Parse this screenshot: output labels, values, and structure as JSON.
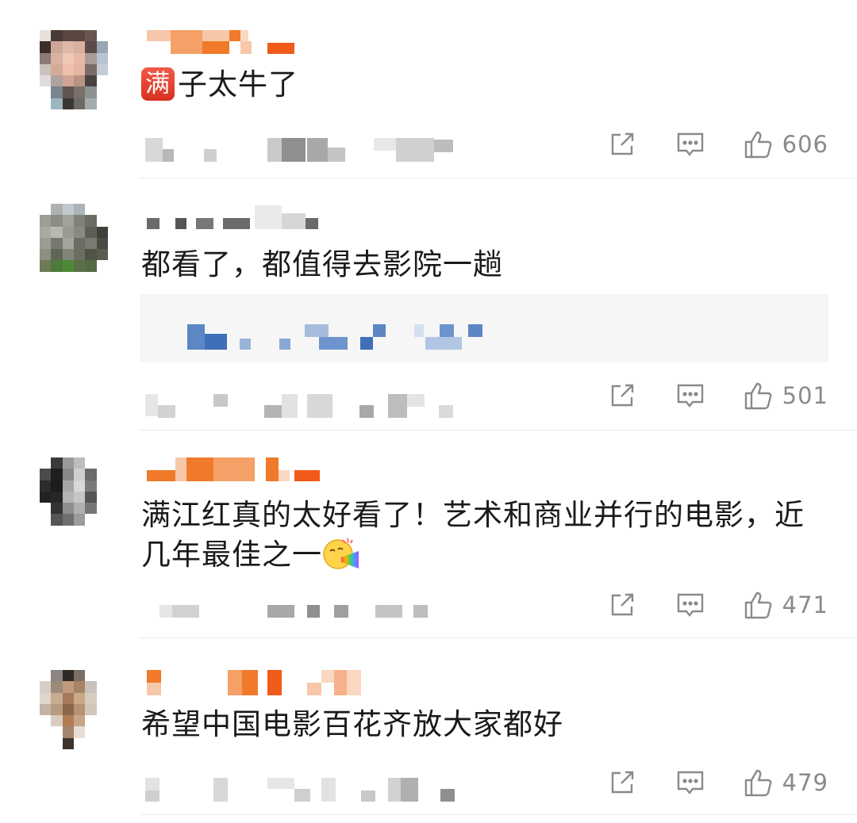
{
  "comments": [
    {
      "badge_text": "满",
      "text": "子太牛了",
      "likes": "606",
      "share_icon": "share-icon",
      "reply_icon": "comment-icon",
      "like_icon": "thumbs-up-icon"
    },
    {
      "text": "都看了，都值得去影院一趟",
      "likes": "501",
      "share_icon": "share-icon",
      "reply_icon": "comment-icon",
      "like_icon": "thumbs-up-icon"
    },
    {
      "text_line1": "满江红真的太好看了！艺术和商业并行的电影，近",
      "text_line2": "几年最佳之一",
      "emoji": "rainbow-vomit-emoji",
      "likes": "471",
      "share_icon": "share-icon",
      "reply_icon": "comment-icon",
      "like_icon": "thumbs-up-icon"
    },
    {
      "text": "希望中国电影百花齐放大家都好",
      "likes": "479",
      "share_icon": "share-icon",
      "reply_icon": "comment-icon",
      "like_icon": "thumbs-up-icon"
    }
  ],
  "colors": {
    "username_accent": "#f07a2a",
    "link_blue": "#4a7fc6",
    "muted": "#8a8a8a",
    "badge_red": "#e0402f"
  }
}
